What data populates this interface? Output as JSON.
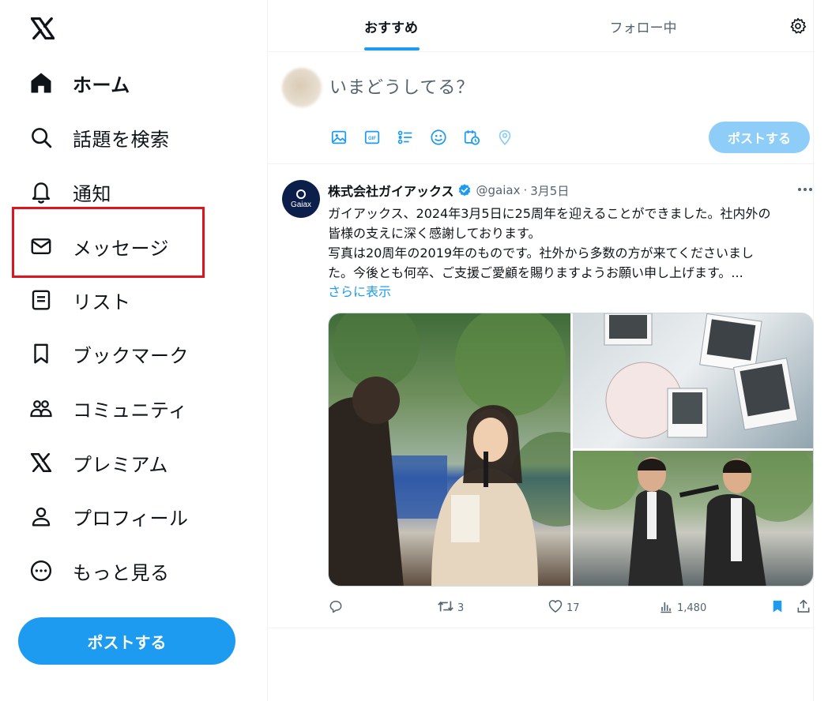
{
  "nav": {
    "logo": "x-logo",
    "items": [
      {
        "label": "ホーム",
        "icon": "home-icon",
        "active": true
      },
      {
        "label": "話題を検索",
        "icon": "search-icon"
      },
      {
        "label": "通知",
        "icon": "bell-icon"
      },
      {
        "label": "メッセージ",
        "icon": "envelope-icon",
        "highlighted": true
      },
      {
        "label": "リスト",
        "icon": "list-icon"
      },
      {
        "label": "ブックマーク",
        "icon": "bookmark-icon"
      },
      {
        "label": "コミュニティ",
        "icon": "people-icon"
      },
      {
        "label": "プレミアム",
        "icon": "x-logo-icon"
      },
      {
        "label": "プロフィール",
        "icon": "person-icon"
      },
      {
        "label": "もっと見る",
        "icon": "more-circle-icon"
      }
    ],
    "post_button": "ポストする"
  },
  "tabs": [
    {
      "label": "おすすめ",
      "active": true
    },
    {
      "label": "フォロー中",
      "active": false
    }
  ],
  "composer": {
    "placeholder": "いまどうしてる？",
    "tools": [
      "image-icon",
      "gif-icon",
      "poll-icon",
      "emoji-icon",
      "schedule-icon",
      "location-icon"
    ],
    "post_button": "ポストする"
  },
  "tweet": {
    "author": "株式会社ガイアックス",
    "avatar_text": "Gaiax",
    "handle": "@gaiax",
    "separator": "·",
    "date": "3月5日",
    "lines": [
      "ガイアックス、2024年3月5日に25周年を迎えることができました。社内外の",
      "皆様の支えに深く感謝しております。",
      "写真は20周年の2019年のものです。社外から多数の方が来てくださいまし",
      "た。今後とも何卒、ご支援ご愛顧を賜りますようお願い申し上げます。..."
    ],
    "show_more": "さらに表示",
    "stats": {
      "replies": "",
      "reposts": "3",
      "likes": "17",
      "views": "1,480"
    }
  },
  "colors": {
    "accent": "#1d9bf0",
    "accent_disabled": "#8ecdf7",
    "highlight": "#e0141e",
    "text": "#0f1419",
    "muted": "#536471"
  }
}
